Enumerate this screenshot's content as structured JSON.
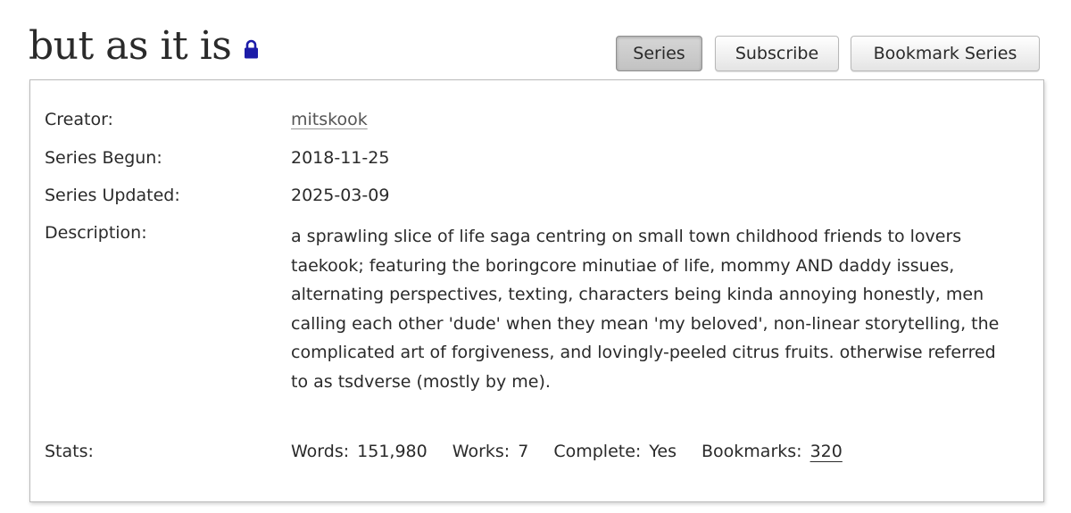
{
  "series": {
    "title": "but as it is",
    "locked_icon": "lock-icon",
    "lock_color": "#1c1ca8"
  },
  "navigation": {
    "series_label": "Series",
    "subscribe_label": "Subscribe",
    "bookmark_label": "Bookmark Series"
  },
  "meta": {
    "creator_label": "Creator:",
    "creator": "mitskook",
    "begun_label": "Series Begun:",
    "begun": "2018-11-25",
    "updated_label": "Series Updated:",
    "updated": "2025-03-09",
    "description_label": "Description:",
    "description": "a sprawling slice of life saga centring on small town childhood friends to lovers taekook; featuring the boringcore minutiae of life, mommy AND daddy issues, alternating perspectives, texting, characters being kinda annoying honestly, men calling each other 'dude' when they mean 'my beloved', non-linear storytelling, the complicated art of forgiveness, and lovingly-peeled citrus fruits. otherwise referred to as tsdverse (mostly by me).",
    "stats_label": "Stats:",
    "stats": {
      "words_label": "Words:",
      "words": "151,980",
      "works_label": "Works:",
      "works": "7",
      "complete_label": "Complete:",
      "complete": "Yes",
      "bookmarks_label": "Bookmarks:",
      "bookmarks": "320"
    }
  }
}
